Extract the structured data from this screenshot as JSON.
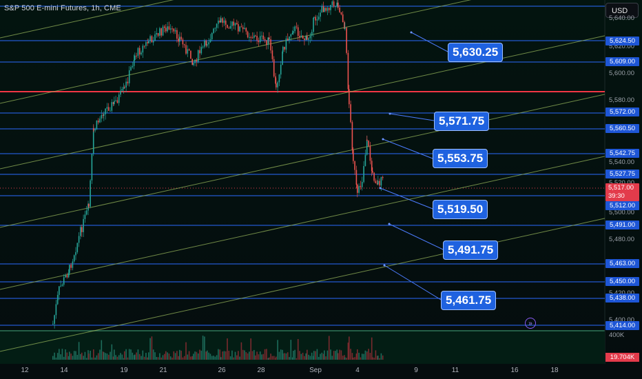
{
  "header": {
    "title": "S&P 500 E-mini Futures, 1h, CME",
    "currency": "USD"
  },
  "price_axis": {
    "labels": [
      "5,640.00",
      "5,620.00",
      "5,600.00",
      "5,580.00",
      "5,540.00",
      "5,520.00",
      "5,500.00",
      "5,480.00",
      "5,420.00",
      "5,400.00"
    ],
    "tags": [
      "5,624.50",
      "5,609.00",
      "5,572.00",
      "5,560.50",
      "5,542.75",
      "5,527.75",
      "5,512.00",
      "5,491.00",
      "5,463.00",
      "5,450.00",
      "5,438.00",
      "5,414.00"
    ],
    "current_price": "5,517.00",
    "countdown": "39:30"
  },
  "volume": {
    "axis_label": "400K",
    "current": "19.704K"
  },
  "time_axis": [
    "12",
    "14",
    "19",
    "21",
    "26",
    "28",
    "Sep",
    "4",
    "9",
    "11",
    "16",
    "18"
  ],
  "callouts": [
    "5,630.25",
    "5,571.75",
    "5,553.75",
    "5,519.50",
    "5,491.75",
    "5,461.75"
  ],
  "colors": {
    "level_line": "#2a6bff",
    "resistance": "#f23645",
    "channel": "#9fbf5f",
    "bull": "#26a69a",
    "bear": "#ef5350",
    "callout": "#1f62e0"
  },
  "icons": {
    "scroll_to_realtime": "go-to-realtime-icon"
  }
}
